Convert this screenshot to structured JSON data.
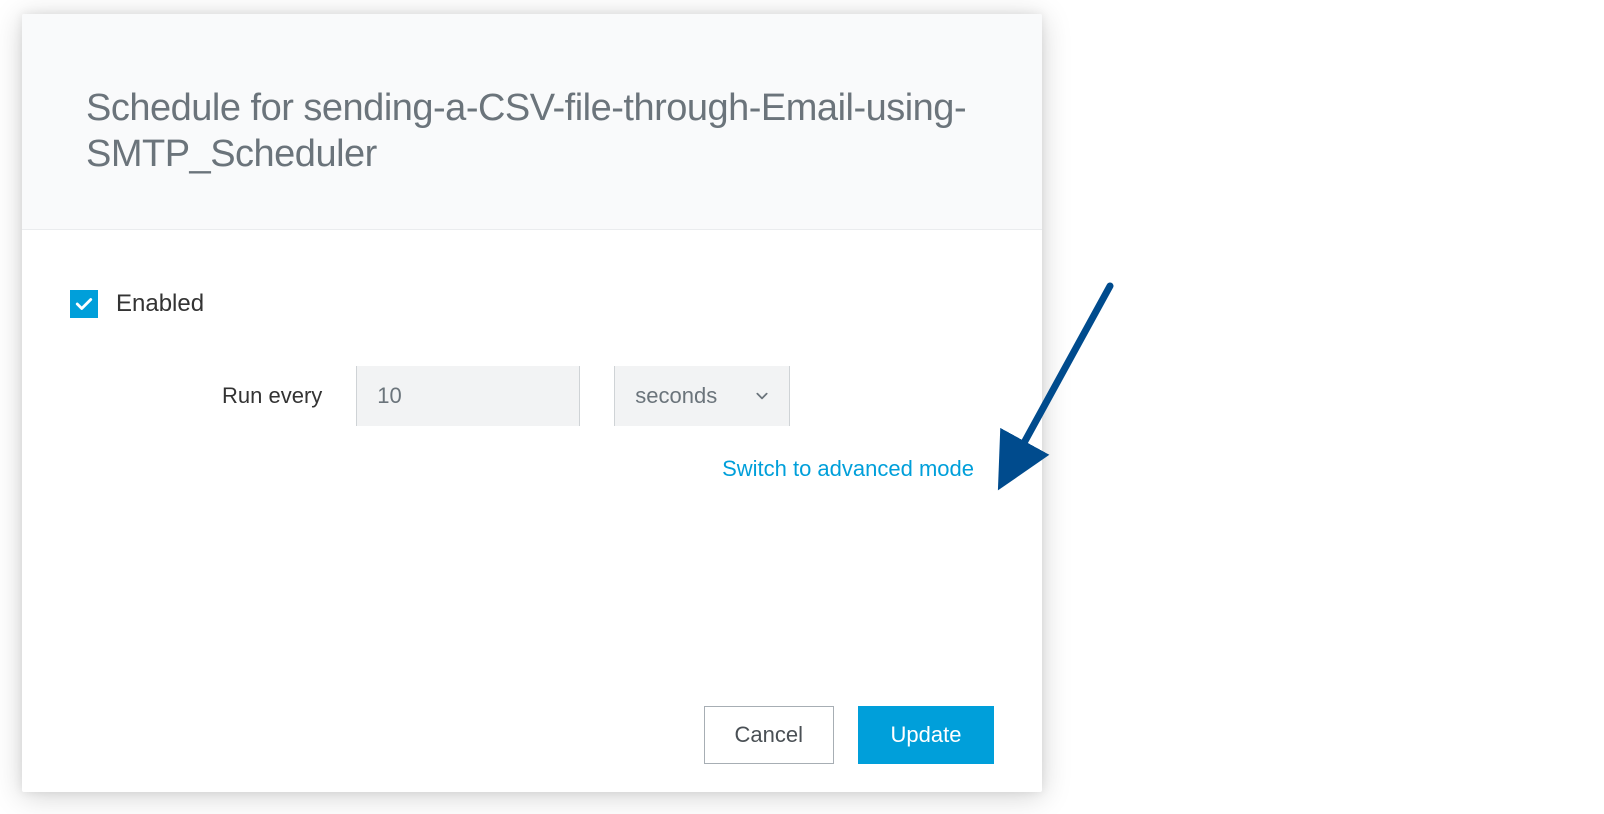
{
  "dialog": {
    "title": "Schedule for sending-a-CSV-file-through-Email-using-SMTP_Scheduler"
  },
  "form": {
    "enabled_label": "Enabled",
    "enabled_checked": true,
    "run_every_label": "Run every",
    "interval_value": "10",
    "unit_selected": "seconds",
    "advanced_mode_link": "Switch to advanced mode"
  },
  "actions": {
    "cancel_label": "Cancel",
    "update_label": "Update"
  },
  "colors": {
    "accent": "#009fda",
    "arrow": "#004b8d"
  }
}
